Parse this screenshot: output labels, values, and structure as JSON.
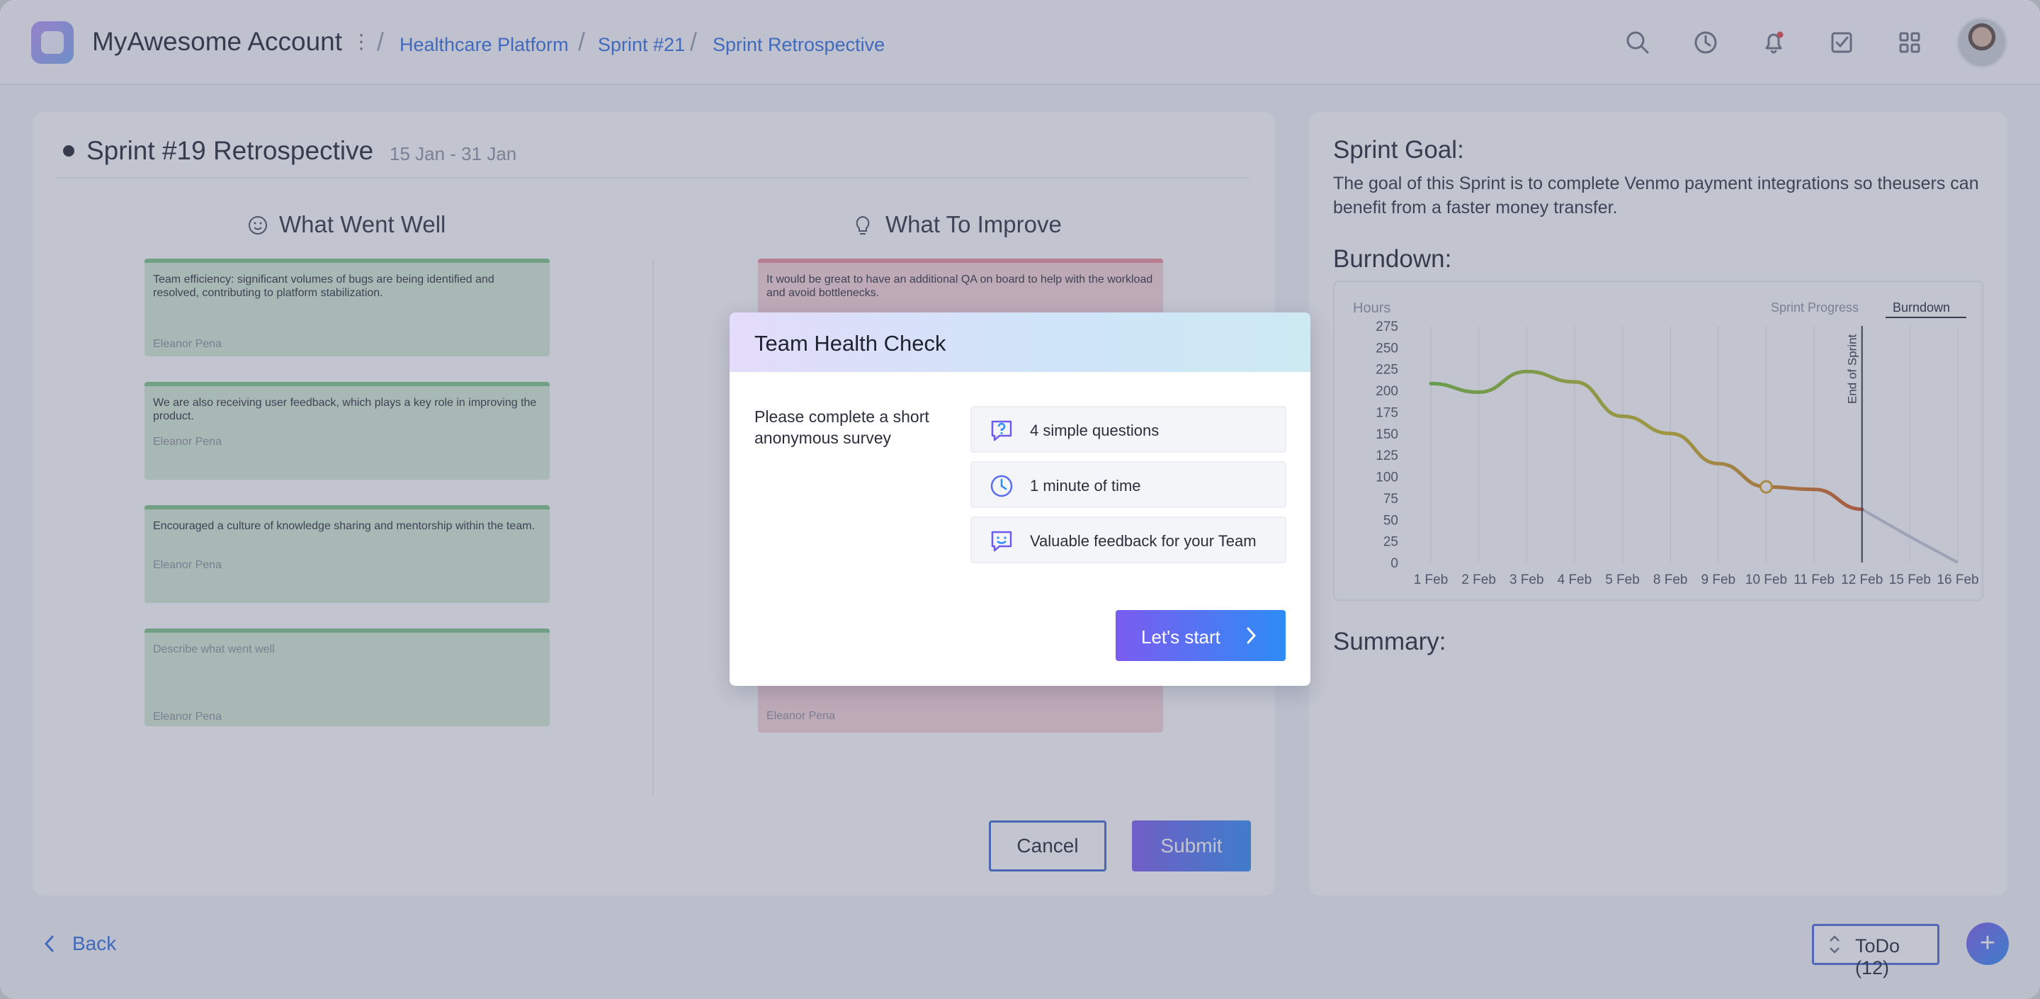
{
  "header": {
    "account_title": "MyAwesome Account",
    "breadcrumbs": [
      "Healthcare Platform",
      "Sprint #21",
      "Sprint Retrospective"
    ]
  },
  "retro": {
    "title": "Sprint #19 Retrospective",
    "dates": "15 Jan - 31 Jan",
    "well": {
      "heading": "What Went Well",
      "notes": [
        {
          "text": "Team efficiency: significant volumes of bugs are being identified and resolved, contributing to platform stabilization.",
          "author": "Eleanor Pena"
        },
        {
          "text": "We are also receiving user feedback, which plays a key role in improving the product.",
          "author": "Eleanor Pena"
        },
        {
          "text": "Encouraged a culture of knowledge sharing and mentorship within the team.",
          "author": "Eleanor Pena"
        },
        {
          "text": "Describe what went well",
          "author": "Eleanor Pena"
        }
      ]
    },
    "improve": {
      "heading": "What To Improve",
      "notes": [
        {
          "text": "It would be great to have an additional QA on board to help with the workload and avoid bottlenecks.",
          "author": ""
        },
        {
          "text": "",
          "author": "Eleanor Pena"
        }
      ]
    },
    "cancel_label": "Cancel",
    "submit_label": "Submit"
  },
  "side": {
    "goal_heading": "Sprint Goal:",
    "goal_text": "The goal of this Sprint is to complete Venmo payment integrations so theusers can benefit from a faster money transfer.",
    "burndown_heading": "Burndown:",
    "summary_heading": "Summary:",
    "tab_progress": "Sprint Progress",
    "tab_burndown": "Burndown"
  },
  "chart_data": {
    "type": "line",
    "ylabel": "Hours",
    "ylim": [
      0,
      275
    ],
    "yticks": [
      0,
      25,
      50,
      75,
      100,
      125,
      150,
      175,
      200,
      225,
      250,
      275
    ],
    "categories": [
      "1 Feb",
      "2 Feb",
      "3 Feb",
      "4 Feb",
      "5 Feb",
      "8 Feb",
      "9 Feb",
      "10 Feb",
      "11 Feb",
      "12 Feb",
      "15 Feb",
      "16 Feb"
    ],
    "series": [
      {
        "values": [
          208,
          198,
          222,
          210,
          170,
          150,
          115,
          88,
          85,
          62
        ]
      },
      {
        "values": [
          62,
          30,
          0
        ],
        "x_start_index": 9
      }
    ],
    "marker": {
      "x": "10 Feb",
      "y": 88
    },
    "vline": {
      "x": "12 Feb",
      "label": "End of Sprint"
    },
    "colors": {
      "start": "#6fbf2f",
      "mid": "#c9b520",
      "end": "#d2541c",
      "projection": "#c4c9d3"
    }
  },
  "footer": {
    "back_label": "Back",
    "todo_label": "ToDo (12)"
  },
  "modal": {
    "title": "Team Health Check",
    "description": "Please complete a short anonymous survey",
    "features": [
      {
        "icon": "question-chat-icon",
        "label": "4 simple questions"
      },
      {
        "icon": "clock-icon",
        "label": "1 minute of time"
      },
      {
        "icon": "smile-chat-icon",
        "label": "Valuable feedback for your Team"
      }
    ],
    "start_label": "Let's start"
  },
  "colors": {
    "accent": "#2f6fe0",
    "gradient_start": "#7b5cf0",
    "gradient_end": "#2d8cf6"
  }
}
